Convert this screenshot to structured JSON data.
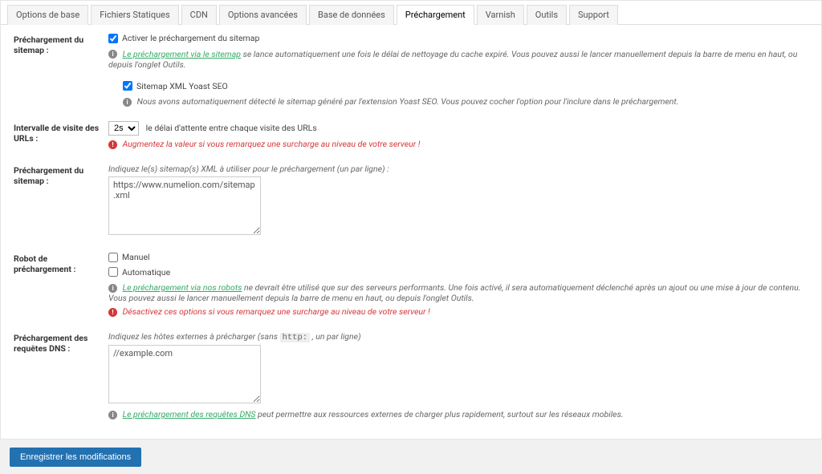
{
  "tabs": [
    {
      "label": "Options de base"
    },
    {
      "label": "Fichiers Statiques"
    },
    {
      "label": "CDN"
    },
    {
      "label": "Options avancées"
    },
    {
      "label": "Base de données"
    },
    {
      "label": "Préchargement",
      "active": true
    },
    {
      "label": "Varnish"
    },
    {
      "label": "Outils"
    },
    {
      "label": "Support"
    }
  ],
  "row1": {
    "label": "Préchargement du sitemap :",
    "checkbox1_label": "Activer le préchargement du sitemap",
    "link1": "Le préchargement via le sitemap",
    "desc1_rest": " se lance automatiquement une fois le délai de nettoyage du cache expiré. Vous pouvez aussi le lancer manuellement depuis la barre de menu en haut, ou depuis l'onglet Outils.",
    "checkbox2_label": "Sitemap XML Yoast SEO",
    "desc2": "Nous avons automatiquement détecté le sitemap généré par l'extension Yoast SEO. Vous pouvez cocher l'option pour l'inclure dans le préchargement."
  },
  "row2": {
    "label": "Intervalle de visite des URLs :",
    "select_value": "2s",
    "after_select": "le délai d'attente entre chaque visite des URLs",
    "warn": "Augmentez la valeur si vous remarquez une surcharge au niveau de votre serveur !"
  },
  "row3": {
    "label": "Préchargement du sitemap :",
    "hint": "Indiquez le(s) sitemap(s) XML à utiliser pour le préchargement (un par ligne) :",
    "textarea_value": "https://www.numelion.com/sitemap.xml"
  },
  "row4": {
    "label": "Robot de préchargement :",
    "cb_manuel": "Manuel",
    "cb_auto": "Automatique",
    "link": "Le préchargement via nos robots",
    "desc_rest": " ne devrait être utilisé que sur des serveurs performants. Une fois activé, il sera automatiquement déclenché après un ajout ou une mise à jour de contenu. Vous pouvez aussi le lancer manuellement depuis la barre de menu en haut, ou depuis l'onglet Outils.",
    "warn": "Désactivez ces options si vous remarquez une surcharge au niveau de votre serveur !"
  },
  "row5": {
    "label": "Préchargement des requêtes DNS :",
    "hint_pre": "Indiquez les hôtes externes à précharger (sans ",
    "hint_code": "http:",
    "hint_post": " , un par ligne)",
    "textarea_value": "//example.com",
    "link": "Le préchargement des requêtes DNS",
    "desc_rest": " peut permettre aux ressources externes de charger plus rapidement, surtout sur les réseaux mobiles."
  },
  "submit": {
    "label": "Enregistrer les modifications"
  }
}
